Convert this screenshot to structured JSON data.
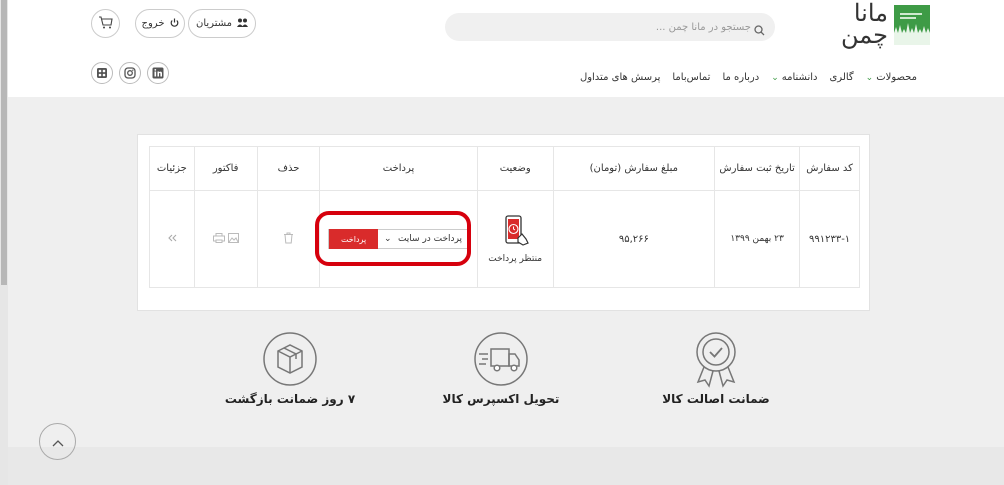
{
  "logo": {
    "text_line1": "مانا",
    "text_line2": "چمن"
  },
  "search": {
    "placeholder": "جستجو در مانا چمن ..."
  },
  "header": {
    "customers_label": "مشتریان",
    "logout_label": "خروج"
  },
  "nav": [
    {
      "label": "محصولات",
      "has_dropdown": true
    },
    {
      "label": "گالری",
      "has_dropdown": false
    },
    {
      "label": "دانشنامه",
      "has_dropdown": true
    },
    {
      "label": "درباره ما",
      "has_dropdown": false
    },
    {
      "label": "تماس‌باما",
      "has_dropdown": false
    },
    {
      "label": "پرسش های متداول",
      "has_dropdown": false
    }
  ],
  "social_icons": [
    "linkedin-icon",
    "instagram-icon",
    "aparat-icon"
  ],
  "orders": {
    "columns": [
      "کد سفارش",
      "تاریخ ثبت سفارش",
      "مبلغ سفارش (تومان)",
      "وضعیت",
      "پرداخت",
      "حذف",
      "فاکتور",
      "جزئیات"
    ],
    "rows": [
      {
        "code": "۹۹۱۲۳۳-۱",
        "date": "۲۳ بهمن ۱۳۹۹",
        "amount": "۹۵,۲۶۶",
        "status": "منتظر پرداخت",
        "payment_method": "پرداخت در سایت",
        "pay_button": "پرداخت"
      }
    ]
  },
  "features": [
    {
      "label": "ضمانت اصالت کالا",
      "icon": "quality-badge-icon"
    },
    {
      "label": "تحویل اکسپرس کالا",
      "icon": "express-truck-icon"
    },
    {
      "label": "۷ روز ضمانت بازگشت",
      "icon": "return-box-icon"
    }
  ],
  "colors": {
    "brand_green": "#3e9b46",
    "pay_red": "#d92b2b",
    "highlight_ring": "#d6000d"
  }
}
